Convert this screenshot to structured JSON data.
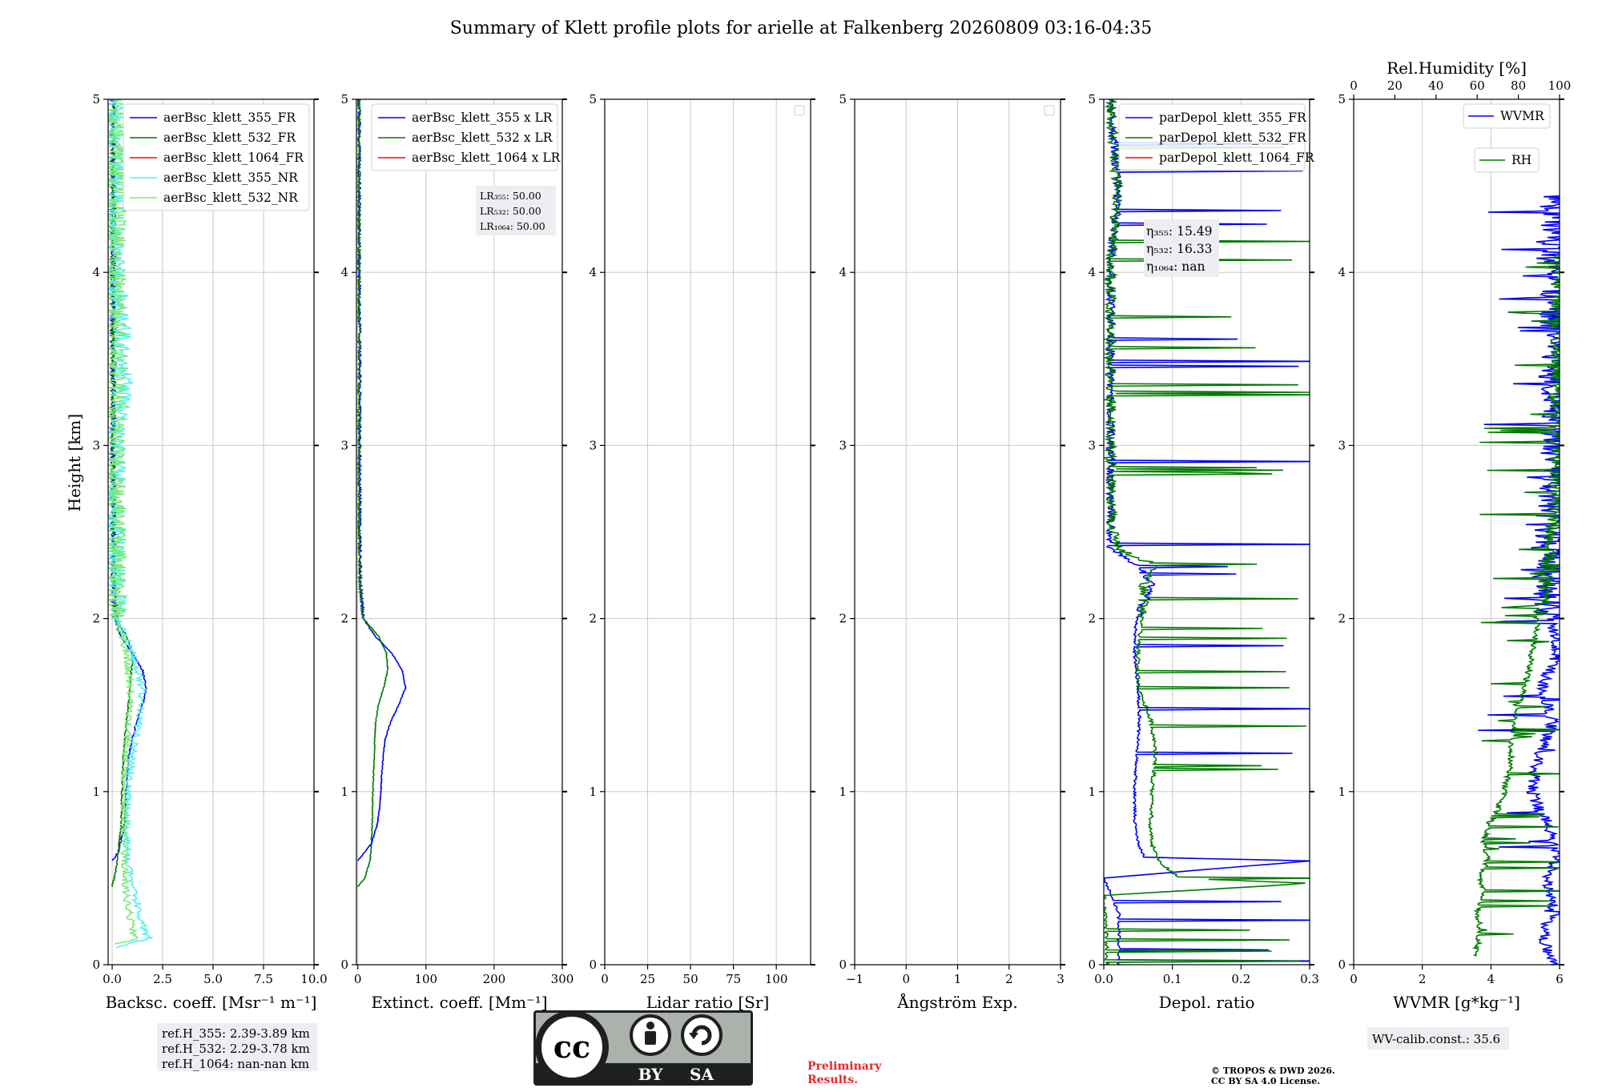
{
  "title": "Summary of Klett profile plots for arielle at Falkenberg 20260809 03:16-04:35",
  "colors": {
    "blue": "#0000ee",
    "green": "#007a00",
    "red": "#ff0000",
    "cyan": "#55f0f0",
    "lightgreen": "#7de87d",
    "grid": "#c8c8c8",
    "box": "#eeeef2",
    "preliminary": "#e8262c"
  },
  "footer": {
    "ref_heights": [
      "ref.H_355: 2.39-3.89 km",
      "ref.H_532: 2.29-3.78 km",
      "ref.H_1064: nan-nan km"
    ],
    "license_badge": {
      "left": "",
      "by": "BY",
      "sa": "SA"
    },
    "preliminary": [
      "Preliminary",
      "Results."
    ],
    "copyright": [
      "© TROPOS & DWD 2026.",
      "CC BY SA 4.0 License."
    ],
    "wv_calib": "WV-calib.const.: 35.6"
  },
  "chart_data": [
    {
      "type": "line",
      "id": "backscatter",
      "xlabel": "Backsc. coeff. [Msr⁻¹ m⁻¹]",
      "ylabel": "Height [km]",
      "xlim": [
        -0.2,
        10
      ],
      "ylim": [
        0,
        5
      ],
      "xticks": [
        0,
        2.5,
        5,
        7.5,
        10
      ],
      "xticklabels": [
        "0.0",
        "2.5",
        "5.0",
        "7.5",
        "10.0"
      ],
      "yticks": [
        0,
        1,
        2,
        3,
        4,
        5
      ],
      "grid": true,
      "legend": "top-right",
      "series": [
        {
          "name": "aerBsc_klett_355_FR",
          "color": "blue",
          "noise": 0.12,
          "y": [
            0.6,
            0.65,
            0.8,
            1.0,
            1.2,
            1.4,
            1.5,
            1.6,
            1.7,
            1.8,
            1.9,
            2.0,
            2.2,
            2.5,
            3.0,
            3.5,
            4.0,
            5.0
          ],
          "x": [
            0.0,
            0.3,
            0.6,
            0.7,
            0.8,
            1.2,
            1.5,
            1.7,
            1.5,
            1.0,
            0.4,
            0.15,
            0.06,
            0.05,
            0.05,
            0.05,
            0.05,
            0.04
          ]
        },
        {
          "name": "aerBsc_klett_532_FR",
          "color": "green",
          "noise": 0.12,
          "y": [
            0.45,
            0.55,
            0.8,
            1.0,
            1.2,
            1.4,
            1.6,
            1.8,
            1.9,
            2.0,
            2.5,
            3.0,
            4.0,
            5.0
          ],
          "x": [
            0.0,
            0.2,
            0.45,
            0.5,
            0.55,
            0.7,
            0.9,
            1.0,
            0.7,
            0.15,
            0.05,
            0.05,
            0.05,
            0.04
          ]
        },
        {
          "name": "aerBsc_klett_1064_FR",
          "color": "red",
          "y": [],
          "x": []
        },
        {
          "name": "aerBsc_klett_355_NR",
          "color": "cyan",
          "noise": 0.5,
          "y": [
            0.1,
            0.15,
            0.2,
            0.4,
            0.6,
            0.8,
            1.0,
            1.2,
            1.4,
            1.6,
            1.8,
            2.0,
            2.2,
            2.5,
            3.0,
            3.4,
            3.7,
            4.0,
            4.5,
            5.0
          ],
          "x": [
            0.1,
            1.8,
            1.6,
            1.1,
            0.8,
            0.7,
            0.8,
            1.0,
            1.3,
            1.5,
            1.0,
            0.3,
            0.2,
            0.2,
            0.2,
            0.6,
            0.4,
            0.2,
            0.2,
            0.1
          ]
        },
        {
          "name": "aerBsc_klett_532_NR",
          "color": "lightgreen",
          "noise": 0.5,
          "y": [
            0.12,
            0.15,
            0.2,
            0.4,
            0.6,
            0.8,
            1.0,
            1.2,
            1.4,
            1.6,
            1.8,
            2.0,
            2.2,
            2.5,
            3.0,
            3.5,
            4.0,
            4.5,
            5.0
          ],
          "x": [
            0.1,
            1.2,
            1.0,
            0.7,
            0.6,
            0.6,
            0.6,
            0.7,
            0.8,
            0.9,
            0.7,
            0.2,
            0.2,
            0.2,
            0.2,
            0.2,
            0.2,
            0.2,
            0.1
          ]
        }
      ]
    },
    {
      "type": "line",
      "id": "extinction",
      "xlabel": "Extinct. coeff. [Mm⁻¹]",
      "xlim": [
        -2,
        300
      ],
      "ylim": [
        0,
        5
      ],
      "xticks": [
        0,
        100,
        200,
        300
      ],
      "xticklabels": [
        "0",
        "100",
        "200",
        "300"
      ],
      "yticks": [
        0,
        1,
        2,
        3,
        4,
        5
      ],
      "grid": true,
      "legend": "top-right",
      "lidar_ratio_box": [
        "LR₃₅₅: 50.00",
        "LR₅₃₂: 50.00",
        "LR₁₀₆₄: 50.00"
      ],
      "series": [
        {
          "name": "aerBsc_klett_355 x LR",
          "color": "blue",
          "noise": 2.0,
          "y": [
            0.6,
            0.65,
            0.7,
            0.8,
            0.9,
            1.0,
            1.1,
            1.2,
            1.3,
            1.4,
            1.5,
            1.6,
            1.7,
            1.8,
            1.9,
            2.0,
            2.2,
            2.5,
            3.0,
            3.5,
            4.0,
            5.0
          ],
          "x": [
            0,
            10,
            20,
            28,
            32,
            34,
            35,
            37,
            40,
            48,
            60,
            70,
            65,
            50,
            25,
            8,
            4,
            3,
            3,
            3,
            2,
            2
          ]
        },
        {
          "name": "aerBsc_klett_532 x LR",
          "color": "green",
          "noise": 2.0,
          "y": [
            0.45,
            0.5,
            0.6,
            0.7,
            0.8,
            1.0,
            1.2,
            1.4,
            1.5,
            1.6,
            1.7,
            1.8,
            1.9,
            2.0,
            2.2,
            2.5,
            3.0,
            4.0,
            5.0
          ],
          "x": [
            0,
            10,
            18,
            20,
            21,
            22,
            24,
            26,
            30,
            38,
            44,
            42,
            30,
            8,
            3,
            2,
            2,
            2,
            2
          ]
        },
        {
          "name": "aerBsc_klett_1064 x LR",
          "color": "red",
          "y": [],
          "x": []
        }
      ]
    },
    {
      "type": "line",
      "id": "lidar_ratio",
      "xlabel": "Lidar ratio [Sr]",
      "xlim": [
        0,
        120
      ],
      "ylim": [
        0,
        5
      ],
      "xticks": [
        0,
        25,
        50,
        75,
        100
      ],
      "xticklabels": [
        "0",
        "25",
        "50",
        "75",
        "100"
      ],
      "yticks": [
        0,
        1,
        2,
        3,
        4,
        5
      ],
      "grid": true,
      "empty_legend": true,
      "series": []
    },
    {
      "type": "line",
      "id": "angstrom",
      "xlabel": "Ångström Exp.",
      "xlim": [
        -1,
        3
      ],
      "ylim": [
        0,
        5
      ],
      "xticks": [
        -1,
        0,
        1,
        2,
        3
      ],
      "xticklabels": [
        "−1",
        "0",
        "1",
        "2",
        "3"
      ],
      "yticks": [
        0,
        1,
        2,
        3,
        4,
        5
      ],
      "grid": true,
      "empty_legend": true,
      "series": []
    },
    {
      "type": "line",
      "id": "depol",
      "xlabel": "Depol. ratio",
      "xlim": [
        0,
        0.3
      ],
      "ylim": [
        0,
        5
      ],
      "xticks": [
        0,
        0.1,
        0.2,
        0.3
      ],
      "xticklabels": [
        "0.0",
        "0.1",
        "0.2",
        "0.3"
      ],
      "yticks": [
        0,
        1,
        2,
        3,
        4,
        5
      ],
      "grid": true,
      "legend": "top-right",
      "eta_box": [
        "η₃₅₅: 15.49",
        "η₅₃₂: 16.33",
        "η₁₀₆₄: nan"
      ],
      "series": [
        {
          "name": "parDepol_klett_355_FR",
          "color": "blue",
          "noise": 0.006,
          "spikes": 18,
          "y": [
            0,
            0.3,
            0.5,
            0.6,
            0.62,
            0.7,
            0.8,
            0.9,
            1.0,
            1.2,
            1.4,
            1.6,
            1.8,
            1.9,
            2.0,
            2.1,
            2.2,
            2.3,
            2.4,
            2.5,
            3.0,
            3.5,
            4.0,
            4.5,
            5.0
          ],
          "x": [
            0.022,
            0.022,
            0.0,
            0.3,
            0.06,
            0.05,
            0.046,
            0.045,
            0.045,
            0.048,
            0.052,
            0.05,
            0.045,
            0.045,
            0.048,
            0.06,
            0.07,
            0.05,
            0.01,
            0.01,
            0.01,
            0.01,
            0.01,
            0.02,
            0.01
          ]
        },
        {
          "name": "parDepol_klett_532_FR",
          "color": "green",
          "noise": 0.008,
          "spikes": 26,
          "y": [
            0,
            0.2,
            0.4,
            0.47,
            0.5,
            0.6,
            0.7,
            0.8,
            0.9,
            1.0,
            1.2,
            1.4,
            1.6,
            1.8,
            2.0,
            2.2,
            2.3,
            2.4,
            2.6,
            3.0,
            3.5,
            4.0,
            4.5,
            5.0
          ],
          "x": [
            0.004,
            0.004,
            0.0,
            0.3,
            0.11,
            0.08,
            0.07,
            0.068,
            0.07,
            0.07,
            0.075,
            0.07,
            0.05,
            0.05,
            0.055,
            0.06,
            0.08,
            0.02,
            0.01,
            0.01,
            0.01,
            0.01,
            0.02,
            0.01
          ]
        },
        {
          "name": "parDepol_klett_1064_FR",
          "color": "red",
          "y": [],
          "x": []
        }
      ]
    },
    {
      "type": "line",
      "id": "wvmr",
      "xlabel": "WVMR [g*kg⁻¹]",
      "xlim": [
        0,
        6
      ],
      "ylim": [
        0,
        5
      ],
      "xticks": [
        0,
        2,
        4,
        6
      ],
      "xticklabels": [
        "0",
        "2",
        "4",
        "6"
      ],
      "yticks": [
        0,
        1,
        2,
        3,
        4,
        5
      ],
      "grid": true,
      "top_axis": {
        "label": "Rel.Humidity [%]",
        "lim": [
          0,
          100
        ],
        "ticks": [
          0,
          20,
          40,
          60,
          80,
          100
        ]
      },
      "legend_entries": [
        {
          "name": "WVMR",
          "color": "blue"
        },
        {
          "name": "RH",
          "color": "green"
        }
      ],
      "series": [
        {
          "name": "WVMR",
          "color": "blue",
          "noise": 0.5,
          "spikes": 40,
          "y": [
            0.0,
            0.1,
            0.2,
            0.3,
            0.4,
            0.5,
            0.6,
            0.7,
            0.8,
            0.9,
            1.0,
            1.2,
            1.4,
            1.6,
            1.8,
            2.0,
            2.2,
            2.4,
            2.6,
            2.8,
            3.0,
            3.2,
            3.4,
            3.6,
            4.1,
            4.45
          ],
          "x": [
            5.8,
            5.6,
            5.5,
            5.9,
            5.7,
            5.6,
            5.9,
            5.8,
            5.7,
            5.4,
            5.2,
            5.4,
            5.8,
            5.5,
            5.9,
            5.8,
            5.7,
            5.6,
            5.8,
            5.9,
            5.9,
            5.9,
            5.9,
            5.9,
            5.9,
            5.9
          ]
        },
        {
          "name": "RH",
          "color": "green",
          "noise": 0.25,
          "spikes": 60,
          "y": [
            0.05,
            0.1,
            0.2,
            0.3,
            0.4,
            0.5,
            0.6,
            0.7,
            0.8,
            0.9,
            1.0,
            1.1,
            1.2,
            1.3,
            1.4,
            1.5,
            1.6,
            1.7,
            1.8,
            1.9,
            2.0,
            2.2,
            2.4,
            2.6,
            4.1
          ],
          "x": [
            3.6,
            3.6,
            3.7,
            3.6,
            3.8,
            3.7,
            3.9,
            3.8,
            3.9,
            4.2,
            4.4,
            4.5,
            4.6,
            4.6,
            4.7,
            4.8,
            5.0,
            5.1,
            5.2,
            5.3,
            5.4,
            5.6,
            5.7,
            5.9,
            6.0
          ]
        }
      ]
    }
  ]
}
